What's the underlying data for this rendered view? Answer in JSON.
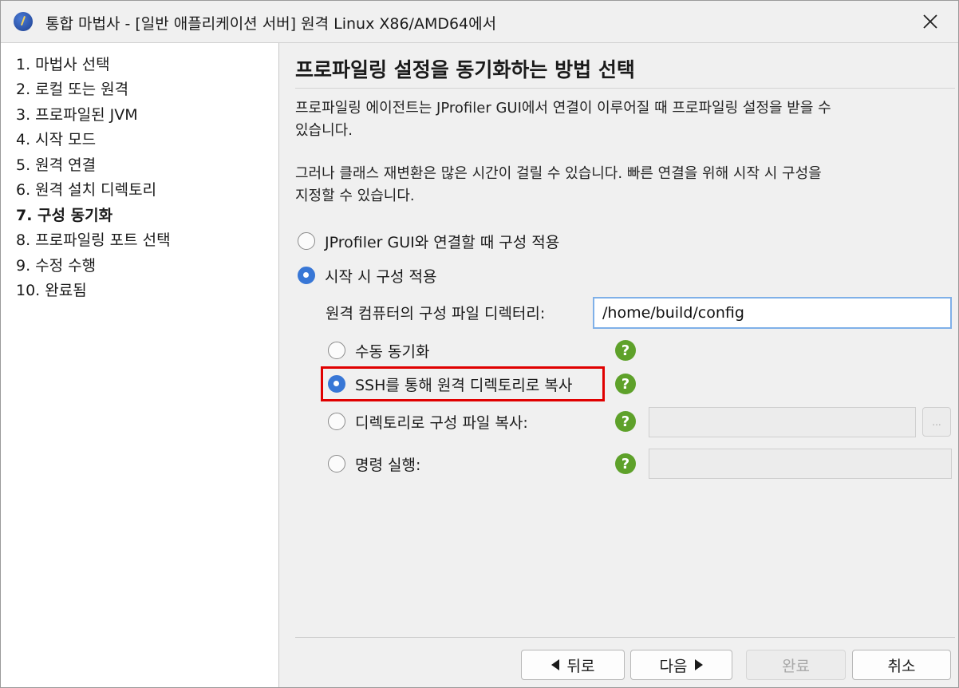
{
  "window": {
    "title": "통합 마법사 - [일반 애플리케이션 서버] 원격 Linux X86/AMD64에서",
    "app_icon": "jprofiler-icon",
    "close_icon": "close-icon"
  },
  "sidebar": {
    "steps": [
      {
        "label": "1. 마법사 선택",
        "active": false
      },
      {
        "label": "2. 로컬 또는 원격",
        "active": false
      },
      {
        "label": "3. 프로파일된 JVM",
        "active": false
      },
      {
        "label": "4. 시작 모드",
        "active": false
      },
      {
        "label": "5. 원격 연결",
        "active": false
      },
      {
        "label": "6. 원격 설치 디렉토리",
        "active": false
      },
      {
        "label": "7. 구성 동기화",
        "active": true
      },
      {
        "label": "8. 프로파일링 포트 선택",
        "active": false
      },
      {
        "label": "9. 수정 수행",
        "active": false
      },
      {
        "label": "10. 완료됨",
        "active": false
      }
    ]
  },
  "main": {
    "heading": "프로파일링 설정을 동기화하는 방법 선택",
    "para1_line1": "프로파일링 에이전트는 JProfiler GUI에서 연결이 이루어질 때 프로파일링 설정을 받을 수",
    "para1_line2": "있습니다.",
    "para2_line1": "그러나 클래스 재변환은 많은 시간이 걸릴 수 있습니다. 빠른 연결을 위해 시작 시 구성을",
    "para2_line2": "지정할 수 있습니다.",
    "options": {
      "apply_on_connect": "JProfiler GUI와 연결할 때 구성 적용",
      "apply_on_startup": "시작 시 구성 적용",
      "selected": "apply_on_startup"
    },
    "config_dir_label": "원격 컴퓨터의 구성 파일 디렉터리:",
    "config_dir_value": "/home/build/config",
    "sync_options": {
      "manual": "수동 동기화",
      "ssh_copy": "SSH를 통해 원격 디렉토리로 복사",
      "copy_to_dir": "디렉토리로 구성 파일 복사:",
      "run_command": "명령 실행:",
      "selected": "ssh_copy"
    },
    "help_glyph": "?",
    "browse_glyph": "..."
  },
  "footer": {
    "back": "뒤로",
    "next": "다음",
    "finish": "완료",
    "cancel": "취소"
  },
  "colors": {
    "accent": "#3877d6",
    "help": "#5ea12a",
    "highlight": "#e00000"
  }
}
